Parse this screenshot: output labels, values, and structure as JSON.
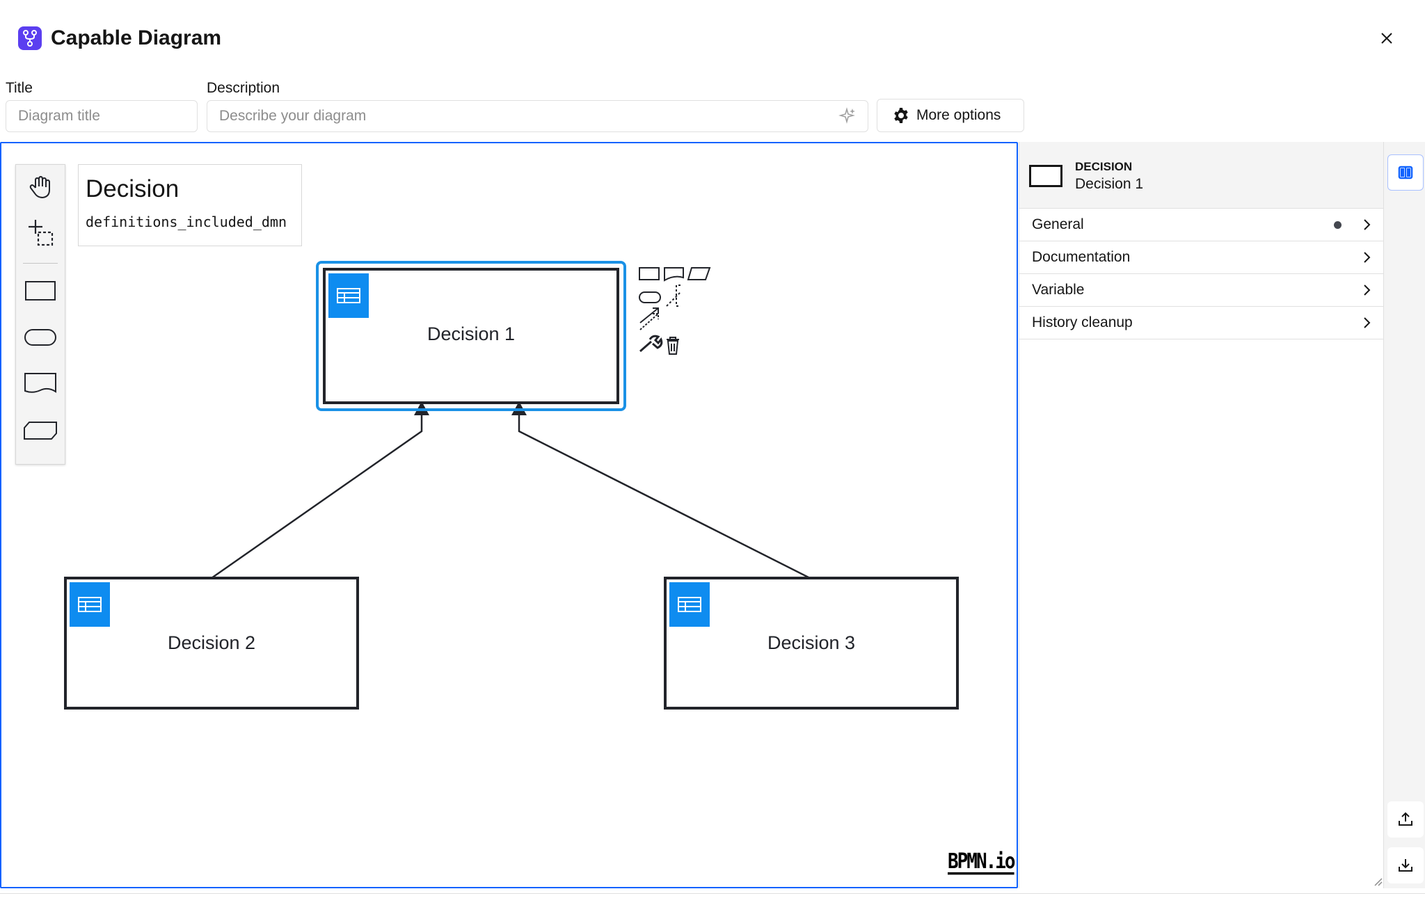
{
  "app": {
    "title": "Capable Diagram",
    "logo_icon": "branch-icon"
  },
  "form": {
    "title_label": "Title",
    "title_placeholder": "Diagram title",
    "title_value": "",
    "description_label": "Description",
    "description_placeholder": "Describe your diagram",
    "description_value": "",
    "more_options_label": "More options"
  },
  "definitions": {
    "name": "Decision",
    "id": "definitions_included_dmn"
  },
  "diagram": {
    "decisions": [
      {
        "label": "Decision 1",
        "selected": true
      },
      {
        "label": "Decision 2",
        "selected": false
      },
      {
        "label": "Decision 3",
        "selected": false
      }
    ],
    "watermark": "BPMN.io"
  },
  "palette": [
    "hand-tool-icon",
    "lasso-tool-icon",
    "decision-shape-icon",
    "input-data-shape-icon",
    "knowledge-source-shape-icon",
    "business-knowledge-model-shape-icon"
  ],
  "properties": {
    "type": "DECISION",
    "name": "Decision 1",
    "groups": [
      {
        "label": "General",
        "has_data": true
      },
      {
        "label": "Documentation",
        "has_data": false
      },
      {
        "label": "Variable",
        "has_data": false
      },
      {
        "label": "History cleanup",
        "has_data": false
      }
    ]
  },
  "colors": {
    "accent": "#0f62fe",
    "selection": "#1a91e6",
    "decision_icon_bg": "#0e8cf0",
    "logo_bg": "#5b3ff0"
  }
}
